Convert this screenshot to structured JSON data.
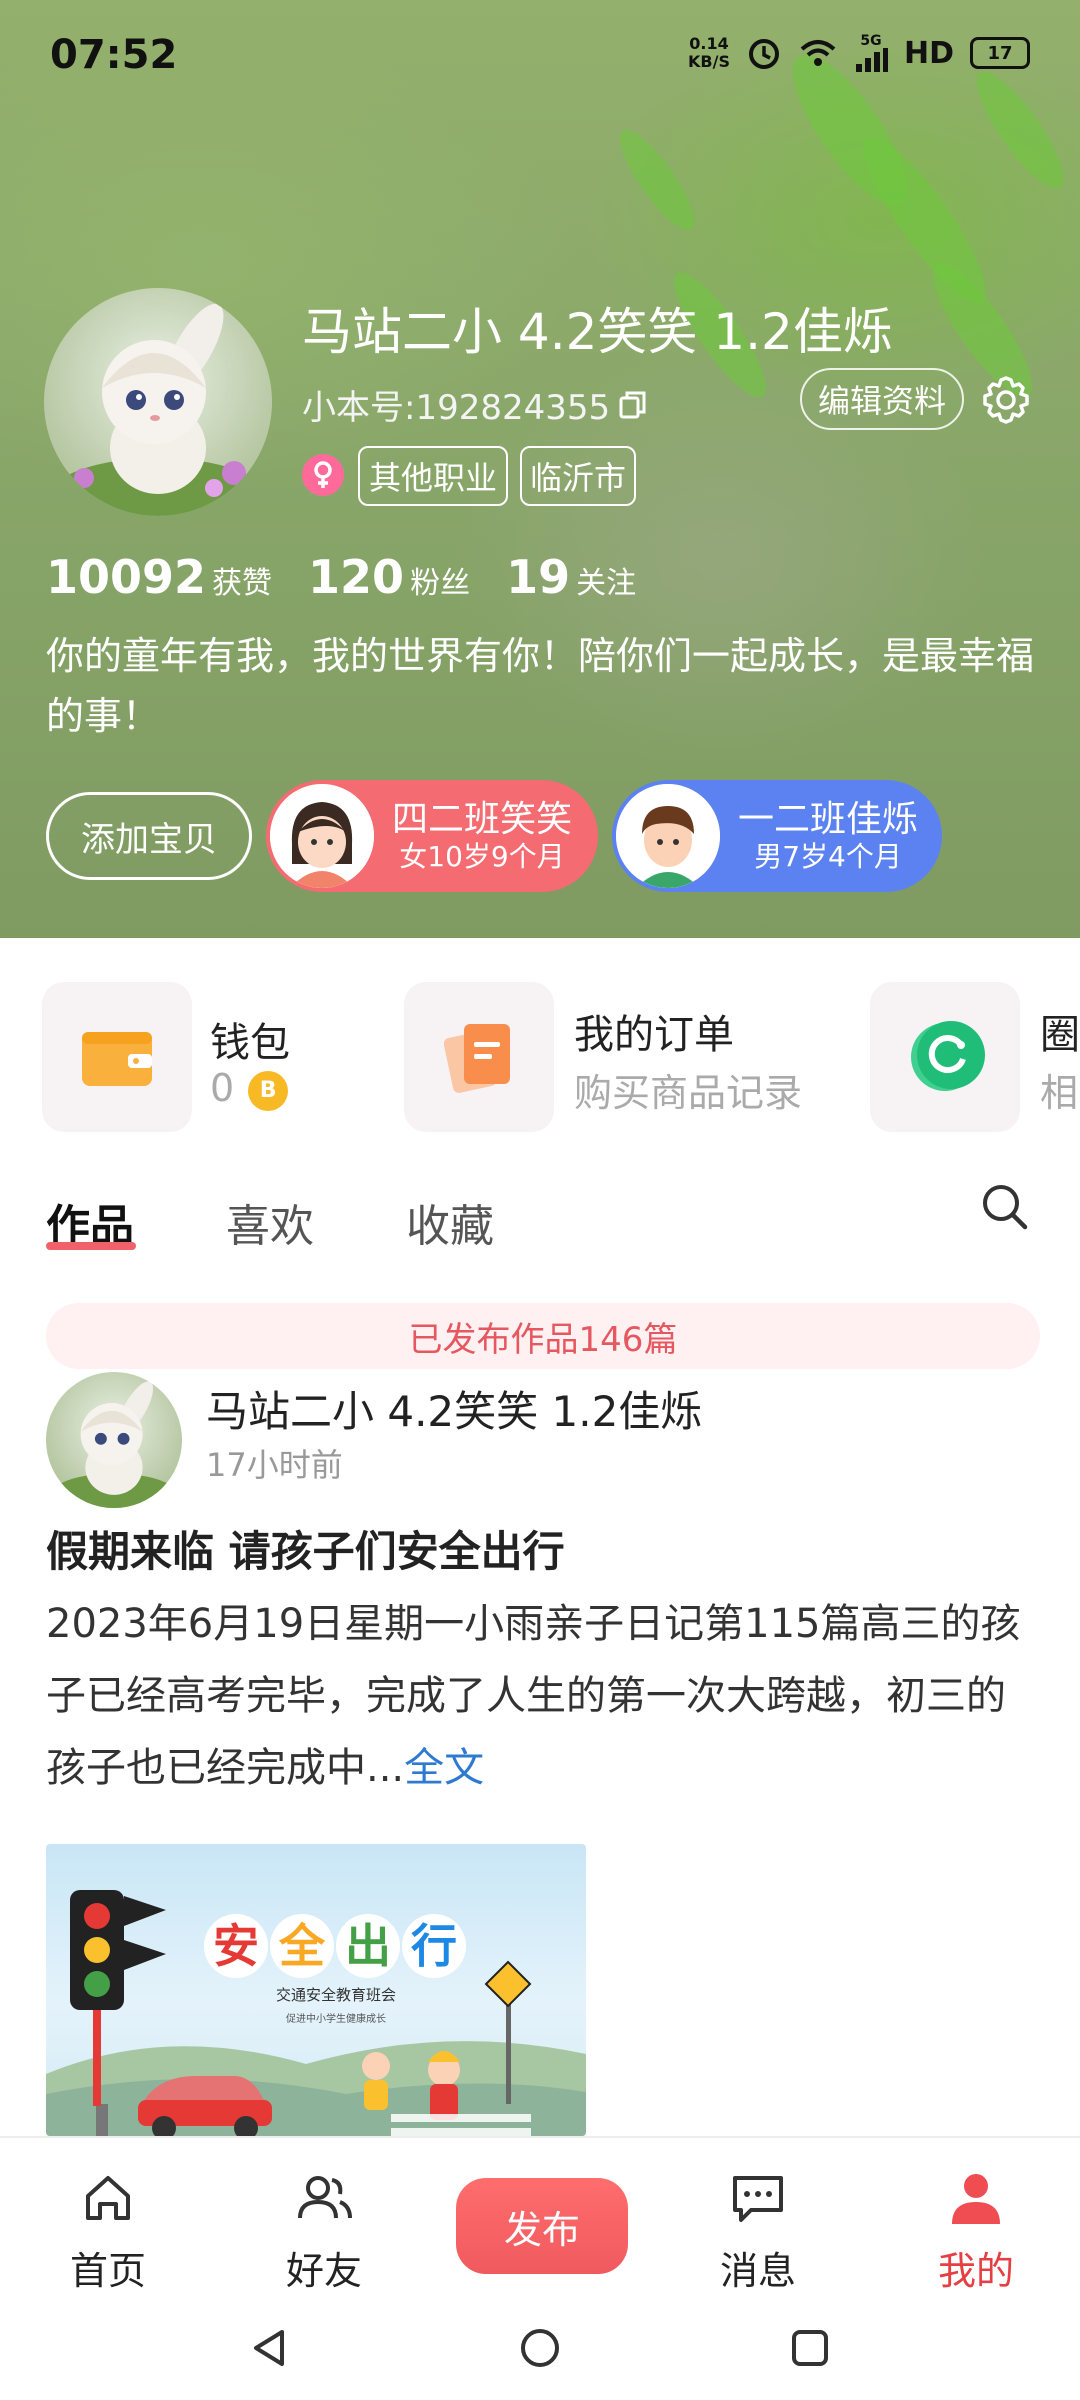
{
  "status_bar": {
    "time": "07:52",
    "speed_top": "0.14",
    "speed_bottom": "KB/S",
    "network": "5G",
    "hd": "HD",
    "battery": "17"
  },
  "profile": {
    "name": "马站二小 4.2笑笑 1.2佳烁",
    "id_label": "小本号:192824355",
    "edit_label": "编辑资料",
    "tags": [
      "其他职业",
      "临沂市"
    ],
    "stats": [
      {
        "num": "10092",
        "label": "获赞"
      },
      {
        "num": "120",
        "label": "粉丝"
      },
      {
        "num": "19",
        "label": "关注"
      }
    ],
    "bio": "你的童年有我，我的世界有你！陪你们一起成长，是最幸福的事！",
    "add_baby": "添加宝贝",
    "kids": [
      {
        "name": "四二班笑笑",
        "age": "女10岁9个月",
        "color": "#f56b72"
      },
      {
        "name": "一二班佳烁",
        "age": "男7岁4个月",
        "color": "#5b82f0"
      }
    ]
  },
  "quick": [
    {
      "title": "钱包",
      "sub": "0",
      "coin": "B"
    },
    {
      "title": "我的订单",
      "sub": "购买商品记录"
    },
    {
      "title": "圈",
      "sub": "相"
    }
  ],
  "tabs": [
    "作品",
    "喜欢",
    "收藏"
  ],
  "post": {
    "banner": "已发布作品146篇",
    "author": "马站二小 4.2笑笑 1.2佳烁",
    "time": "17小时前",
    "title": "假期来临 请孩子们安全出行",
    "body": "2023年6月19日星期一小雨亲子日记第115篇高三的孩子已经高考完毕，完成了人生的第一次大跨越，初三的孩子也已经完成中...",
    "more": "全文",
    "image": {
      "chars": [
        "安",
        "全",
        "出",
        "行"
      ],
      "line1": "交通安全教育班会",
      "line2": "促进中小学生健康成长"
    }
  },
  "bottom_nav": {
    "home": "首页",
    "friends": "好友",
    "publish": "发布",
    "messages": "消息",
    "mine": "我的"
  }
}
